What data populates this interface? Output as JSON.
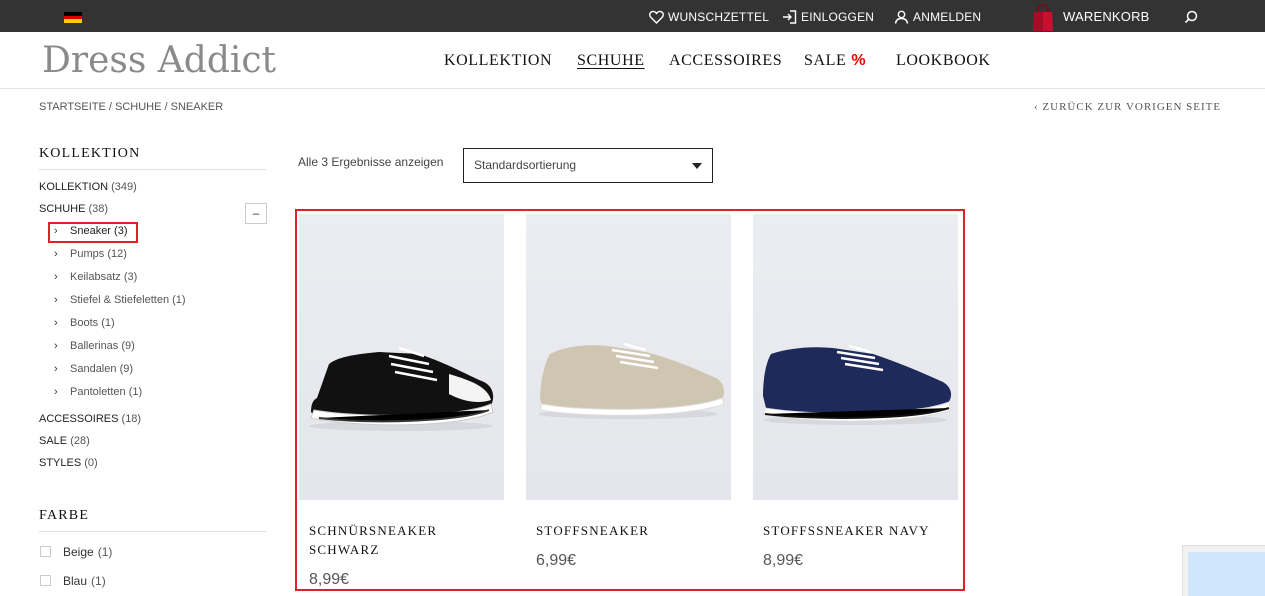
{
  "topbar": {
    "language_flag": "germany-flag-icon",
    "wishlist": "WUNSCHZETTEL",
    "login": "EINLOGGEN",
    "register": "ANMELDEN",
    "cart": "WARENKORB"
  },
  "header": {
    "logo": "Dress Addict",
    "nav": [
      "KOLLEKTION",
      "SCHUHE",
      "ACCESSOIRES",
      "SALE",
      "LOOKBOOK"
    ],
    "sale_symbol": "%",
    "active_nav": "SCHUHE"
  },
  "breadcrumb": "STARTSEITE / SCHUHE / SNEAKER",
  "back_link": "‹ ZURÜCK ZUR VORIGEN SEITE",
  "sidebar": {
    "collection_heading": "KOLLEKTION",
    "categories_top": [
      {
        "label": "KOLLEKTION",
        "count": "(349)"
      },
      {
        "label": "SCHUHE",
        "count": "(38)"
      }
    ],
    "collapse_symbol": "–",
    "subcategories": [
      {
        "label": "Sneaker",
        "count": "(3)"
      },
      {
        "label": "Pumps",
        "count": "(12)"
      },
      {
        "label": "Keilabsatz",
        "count": "(3)"
      },
      {
        "label": "Stiefel & Stiefeletten",
        "count": "(1)"
      },
      {
        "label": "Boots",
        "count": "(1)"
      },
      {
        "label": "Ballerinas",
        "count": "(9)"
      },
      {
        "label": "Sandalen",
        "count": "(9)"
      },
      {
        "label": "Pantoletten",
        "count": "(1)"
      }
    ],
    "categories_bottom": [
      {
        "label": "ACCESSOIRES",
        "count": "(18)"
      },
      {
        "label": "SALE",
        "count": "(28)"
      },
      {
        "label": "STYLES",
        "count": "(0)"
      }
    ],
    "color_heading": "FARBE",
    "colors": [
      {
        "label": "Beige",
        "count": "(1)"
      },
      {
        "label": "Blau",
        "count": "(1)"
      }
    ]
  },
  "toolbar": {
    "result_count": "Alle 3 Ergebnisse anzeigen",
    "sort_value": "Standardsortierung"
  },
  "products": [
    {
      "name": "SCHNÜRSNEAKER SCHWARZ",
      "price": "8,99€",
      "shoe_color": "#111111"
    },
    {
      "name": "STOFFSNEAKER",
      "price": "6,99€",
      "shoe_color": "#cfc6b2"
    },
    {
      "name": "STOFFSSNEAKER NAVY",
      "price": "8,99€",
      "shoe_color": "#1e2a5a"
    }
  ],
  "colors": {
    "topbar_bg": "#333333",
    "highlight": "#e0202a",
    "sale_accent": "#ee0000",
    "cart_bag": "#c8102e"
  }
}
